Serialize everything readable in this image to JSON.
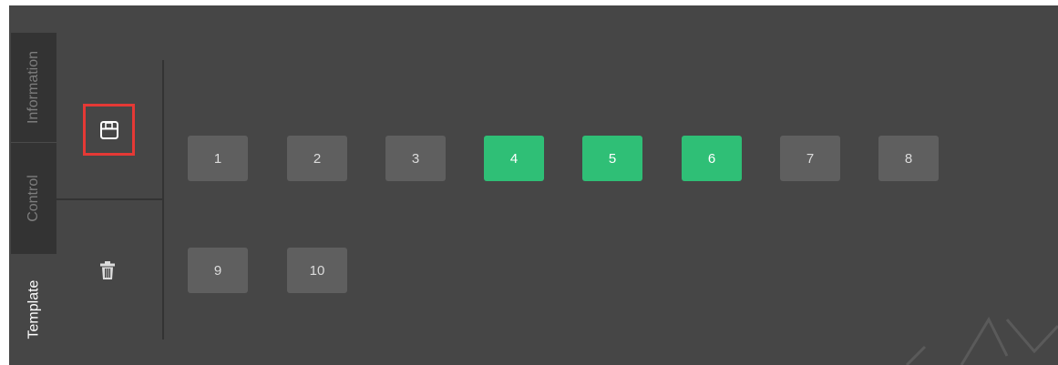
{
  "tabs": [
    {
      "label": "Information",
      "state": "inactive"
    },
    {
      "label": "Control",
      "state": "inactive"
    },
    {
      "label": "Template",
      "state": "active"
    }
  ],
  "tools": {
    "save_icon": "floppy-disk-icon",
    "delete_icon": "trash-icon"
  },
  "templates": [
    {
      "label": "1",
      "active": false
    },
    {
      "label": "2",
      "active": false
    },
    {
      "label": "3",
      "active": false
    },
    {
      "label": "4",
      "active": true
    },
    {
      "label": "5",
      "active": true
    },
    {
      "label": "6",
      "active": true
    },
    {
      "label": "7",
      "active": false
    },
    {
      "label": "8",
      "active": false
    },
    {
      "label": "9",
      "active": false
    },
    {
      "label": "10",
      "active": false
    }
  ],
  "colors": {
    "panel_bg": "#464646",
    "tab_inactive_bg": "#333333",
    "button_default": "#5f5f5f",
    "button_active": "#2fbf76",
    "highlight_border": "#e53935"
  }
}
